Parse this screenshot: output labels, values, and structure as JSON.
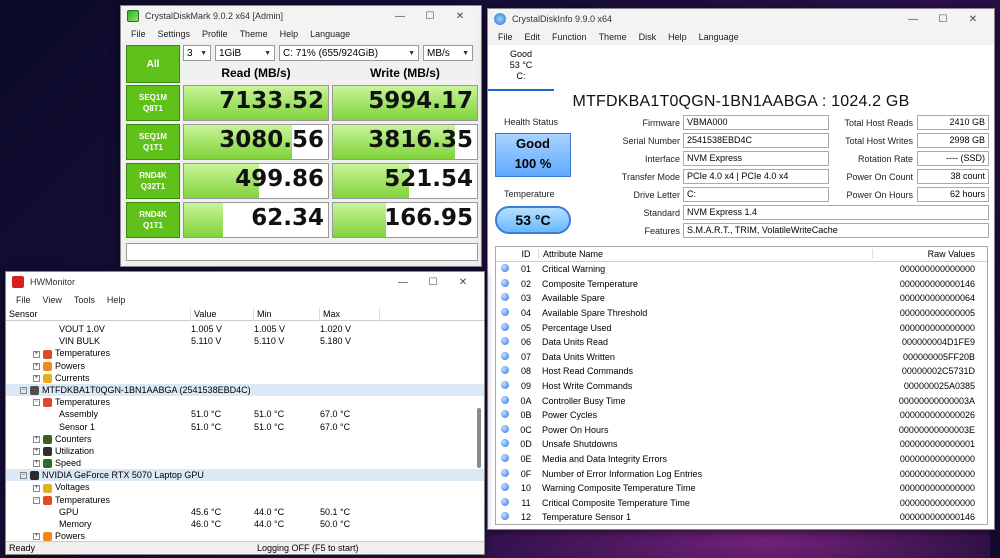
{
  "cdm": {
    "title": "CrystalDiskMark 9.0.2 x64 [Admin]",
    "menu": [
      "File",
      "Settings",
      "Profile",
      "Theme",
      "Help",
      "Language"
    ],
    "count": "3",
    "size": "1GiB",
    "drive": "C: 71% (655/924GiB)",
    "unit": "MB/s",
    "all_label": "All",
    "read_header": "Read (MB/s)",
    "write_header": "Write (MB/s)",
    "tests": [
      {
        "line1": "SEQ1M",
        "line2": "Q8T1",
        "read": "7133.52",
        "write": "5994.17",
        "read_fill": 1.0,
        "write_fill": 1.0
      },
      {
        "line1": "SEQ1M",
        "line2": "Q1T1",
        "read": "3080.56",
        "write": "3816.35",
        "read_fill": 0.75,
        "write_fill": 0.85
      },
      {
        "line1": "RND4K",
        "line2": "Q32T1",
        "read": "499.86",
        "write": "521.54",
        "read_fill": 0.52,
        "write_fill": 0.53
      },
      {
        "line1": "RND4K",
        "line2": "Q1T1",
        "read": "62.34",
        "write": "166.95",
        "read_fill": 0.27,
        "write_fill": 0.37
      }
    ]
  },
  "cdi": {
    "title": "CrystalDiskInfo 9.9.0 x64",
    "menu": [
      "File",
      "Edit",
      "Function",
      "Theme",
      "Disk",
      "Help",
      "Language"
    ],
    "disk_status": "Good",
    "disk_temp": "53 °C",
    "disk_letter": "C:",
    "model": "MTFDKBA1T0QGN-1BN1AABGA : 1024.2 GB",
    "health_label": "Health Status",
    "health_value": "Good",
    "health_percent": "100 %",
    "temp_label": "Temperature",
    "temp_value": "53 °C",
    "firmware_label": "Firmware",
    "firmware": "VBMA000",
    "serial_label": "Serial Number",
    "serial": "2541538EBD4C",
    "interface_label": "Interface",
    "interface": "NVM Express",
    "transfer_label": "Transfer Mode",
    "transfer": "PCIe 4.0 x4 | PCIe 4.0 x4",
    "drive_label": "Drive Letter",
    "drive": "C:",
    "standard_label": "Standard",
    "standard": "NVM Express 1.4",
    "features_label": "Features",
    "features": "S.M.A.R.T., TRIM, VolatileWriteCache",
    "thr_label": "Total Host Reads",
    "thr": "2410 GB",
    "thw_label": "Total Host Writes",
    "thw": "2998 GB",
    "rot_label": "Rotation Rate",
    "rot": "---- (SSD)",
    "poc_label": "Power On Count",
    "poc": "38 count",
    "poh_label": "Power On Hours",
    "poh": "62 hours",
    "attr_headers": {
      "id": "ID",
      "name": "Attribute Name",
      "raw": "Raw Values"
    },
    "attributes": [
      {
        "id": "01",
        "name": "Critical Warning",
        "raw": "000000000000000"
      },
      {
        "id": "02",
        "name": "Composite Temperature",
        "raw": "000000000000146"
      },
      {
        "id": "03",
        "name": "Available Spare",
        "raw": "000000000000064"
      },
      {
        "id": "04",
        "name": "Available Spare Threshold",
        "raw": "000000000000005"
      },
      {
        "id": "05",
        "name": "Percentage Used",
        "raw": "000000000000000"
      },
      {
        "id": "06",
        "name": "Data Units Read",
        "raw": "000000004D1FE9"
      },
      {
        "id": "07",
        "name": "Data Units Written",
        "raw": "000000005FF20B"
      },
      {
        "id": "08",
        "name": "Host Read Commands",
        "raw": "00000002C5731D"
      },
      {
        "id": "09",
        "name": "Host Write Commands",
        "raw": "000000025A0385"
      },
      {
        "id": "0A",
        "name": "Controller Busy Time",
        "raw": "00000000000003A"
      },
      {
        "id": "0B",
        "name": "Power Cycles",
        "raw": "000000000000026"
      },
      {
        "id": "0C",
        "name": "Power On Hours",
        "raw": "00000000000003E"
      },
      {
        "id": "0D",
        "name": "Unsafe Shutdowns",
        "raw": "000000000000001"
      },
      {
        "id": "0E",
        "name": "Media and Data Integrity Errors",
        "raw": "000000000000000"
      },
      {
        "id": "0F",
        "name": "Number of Error Information Log Entries",
        "raw": "000000000000000"
      },
      {
        "id": "10",
        "name": "Warning Composite Temperature Time",
        "raw": "000000000000000"
      },
      {
        "id": "11",
        "name": "Critical Composite Temperature Time",
        "raw": "000000000000000"
      },
      {
        "id": "12",
        "name": "Temperature Sensor 1",
        "raw": "000000000000146"
      }
    ]
  },
  "hwm": {
    "title": "HWMonitor",
    "menu": [
      "File",
      "View",
      "Tools",
      "Help"
    ],
    "headers": {
      "sensor": "Sensor",
      "value": "Value",
      "min": "Min",
      "max": "Max"
    },
    "rows": [
      {
        "indent": 3,
        "icon": "",
        "expander": "",
        "name": "VOUT 1.0V",
        "value": "1.005 V",
        "min": "1.005 V",
        "max": "1.020 V",
        "sel": false
      },
      {
        "indent": 3,
        "icon": "",
        "expander": "",
        "name": "VIN BULK",
        "value": "5.110 V",
        "min": "5.110 V",
        "max": "5.180 V",
        "sel": false
      },
      {
        "indent": 1,
        "icon": "thermometer-icon",
        "expander": "+",
        "name": "Temperatures",
        "value": "",
        "min": "",
        "max": "",
        "sel": false
      },
      {
        "indent": 1,
        "icon": "flame-icon",
        "expander": "+",
        "name": "Powers",
        "value": "",
        "min": "",
        "max": "",
        "sel": false
      },
      {
        "indent": 1,
        "icon": "current-icon",
        "expander": "+",
        "name": "Currents",
        "value": "",
        "min": "",
        "max": "",
        "sel": false
      },
      {
        "indent": 0,
        "icon": "drive-icon",
        "expander": "-",
        "name": "MTFDKBA1T0QGN-1BN1AABGA (2541538EBD4C)",
        "value": "",
        "min": "",
        "max": "",
        "sel": true
      },
      {
        "indent": 1,
        "icon": "thermometer-icon",
        "expander": "-",
        "name": "Temperatures",
        "value": "",
        "min": "",
        "max": "",
        "sel": false
      },
      {
        "indent": 3,
        "icon": "",
        "expander": "",
        "name": "Assembly",
        "value": "51.0 °C",
        "min": "51.0 °C",
        "max": "67.0 °C",
        "sel": false
      },
      {
        "indent": 3,
        "icon": "",
        "expander": "",
        "name": "Sensor 1",
        "value": "51.0 °C",
        "min": "51.0 °C",
        "max": "67.0 °C",
        "sel": false
      },
      {
        "indent": 1,
        "icon": "counter-icon",
        "expander": "+",
        "name": "Counters",
        "value": "",
        "min": "",
        "max": "",
        "sel": false
      },
      {
        "indent": 1,
        "icon": "utilization-icon",
        "expander": "+",
        "name": "Utilization",
        "value": "",
        "min": "",
        "max": "",
        "sel": false
      },
      {
        "indent": 1,
        "icon": "speed-icon",
        "expander": "+",
        "name": "Speed",
        "value": "",
        "min": "",
        "max": "",
        "sel": false
      },
      {
        "indent": 0,
        "icon": "gpu-icon",
        "expander": "-",
        "name": "NVIDIA GeForce RTX 5070 Laptop GPU",
        "value": "",
        "min": "",
        "max": "",
        "sel": true
      },
      {
        "indent": 1,
        "icon": "voltage-icon",
        "expander": "+",
        "name": "Voltages",
        "value": "",
        "min": "",
        "max": "",
        "sel": false
      },
      {
        "indent": 1,
        "icon": "thermometer-icon",
        "expander": "-",
        "name": "Temperatures",
        "value": "",
        "min": "",
        "max": "",
        "sel": false
      },
      {
        "indent": 3,
        "icon": "",
        "expander": "",
        "name": "GPU",
        "value": "45.6 °C",
        "min": "44.0 °C",
        "max": "50.1 °C",
        "sel": false
      },
      {
        "indent": 3,
        "icon": "",
        "expander": "",
        "name": "Memory",
        "value": "46.0 °C",
        "min": "44.0 °C",
        "max": "50.0 °C",
        "sel": false
      },
      {
        "indent": 1,
        "icon": "flame-icon",
        "expander": "+",
        "name": "Powers",
        "value": "",
        "min": "",
        "max": "",
        "sel": false
      }
    ],
    "status_left": "Ready",
    "status_right": "Logging OFF (F5 to start)"
  },
  "colors": {
    "cdm_green": "#5fc11a",
    "cdi_health_blue": "#5ea8ff",
    "hw_selection": "#dbe8f6",
    "desktop_bg": "#1a0d3a"
  }
}
